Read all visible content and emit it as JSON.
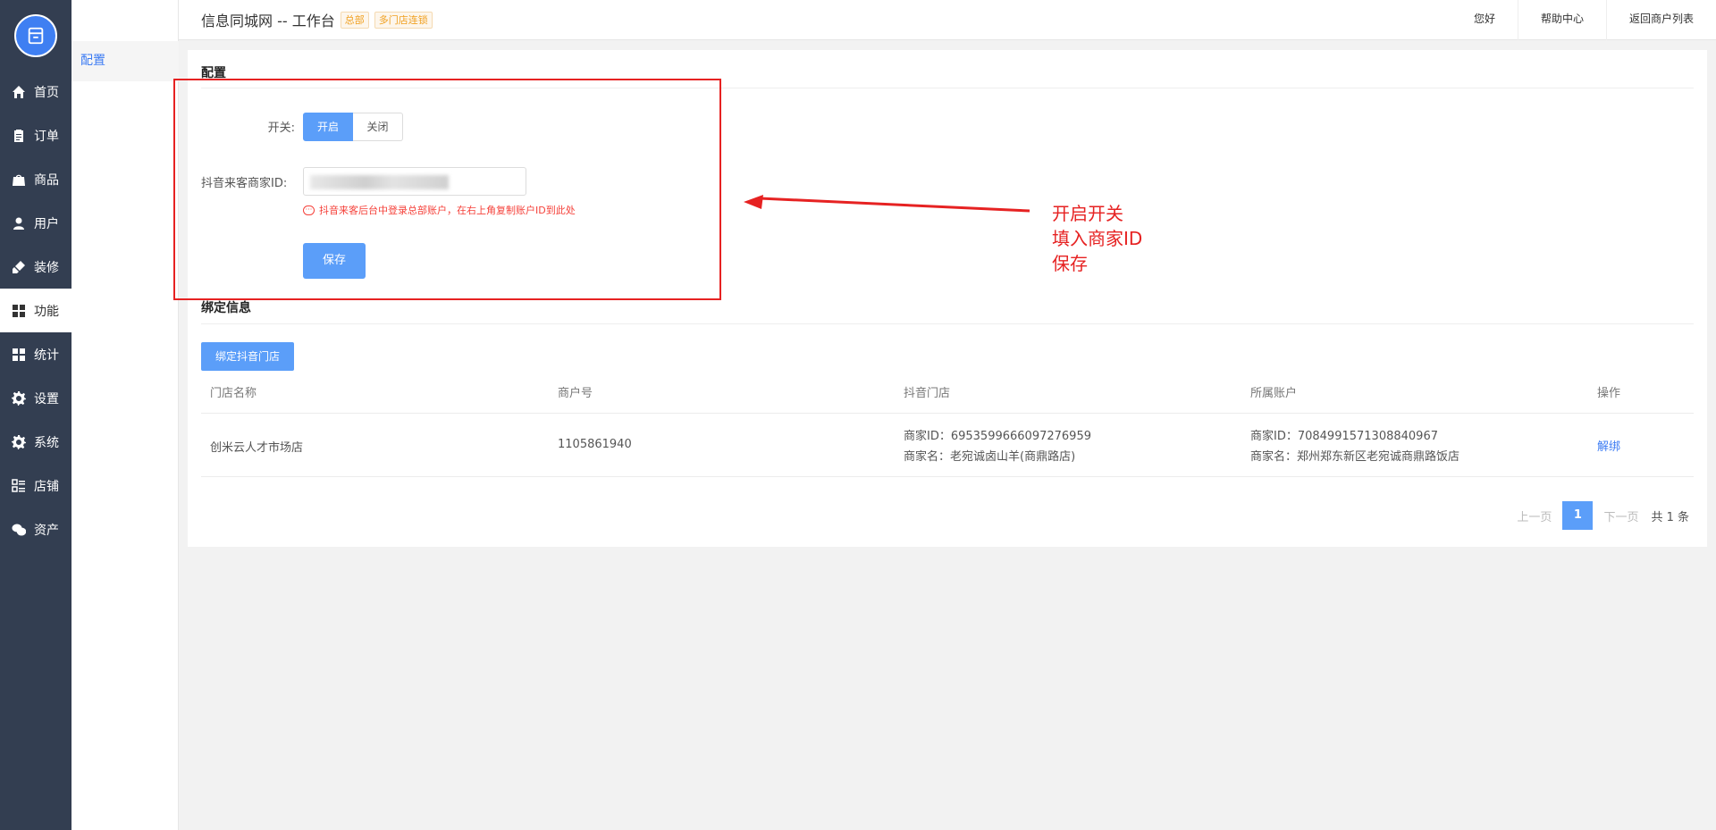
{
  "nav": {
    "items": [
      {
        "label": "首页",
        "icon": "home-icon"
      },
      {
        "label": "订单",
        "icon": "clipboard-icon"
      },
      {
        "label": "商品",
        "icon": "bag-icon"
      },
      {
        "label": "用户",
        "icon": "user-icon"
      },
      {
        "label": "装修",
        "icon": "brush-icon"
      },
      {
        "label": "功能",
        "icon": "grid-icon",
        "active": true
      },
      {
        "label": "统计",
        "icon": "grid-icon"
      },
      {
        "label": "设置",
        "icon": "gear-icon"
      },
      {
        "label": "系统",
        "icon": "gear-icon"
      },
      {
        "label": "店铺",
        "icon": "list-icon"
      },
      {
        "label": "资产",
        "icon": "wechat-icon"
      }
    ]
  },
  "subnav": {
    "active_label": "配置"
  },
  "topbar": {
    "title": "信息同城网 -- 工作台",
    "badge1": "总部",
    "badge2": "多门店连锁",
    "links": [
      "您好",
      "帮助中心",
      "返回商户列表"
    ]
  },
  "config": {
    "section_title": "配置",
    "switch_label": "开关:",
    "switch_on": "开启",
    "switch_off": "关闭",
    "merchant_id_label": "抖音来客商家ID:",
    "merchant_id_value": "",
    "hint": "抖音来客后台中登录总部账户，在右上角复制账户ID到此处",
    "save_label": "保存"
  },
  "bind": {
    "section_title": "绑定信息",
    "bind_button": "绑定抖音门店",
    "columns": [
      "门店名称",
      "商户号",
      "抖音门店",
      "所属账户",
      "操作"
    ],
    "rows": [
      {
        "store_name": "创米云人才市场店",
        "merchant_no": "1105861940",
        "douyin_id": "商家ID：6953599666097276959",
        "douyin_name": "商家名：老宛诚卤山羊(商鼎路店)",
        "account_id": "商家ID：7084991571308840967",
        "account_name": "商家名：郑州郑东新区老宛诚商鼎路饭店",
        "action": "解绑"
      }
    ]
  },
  "pager": {
    "prev": "上一页",
    "current": "1",
    "next": "下一页",
    "total": "共 1 条"
  },
  "annotation": {
    "lines": [
      "开启开关",
      "填入商家ID",
      "保存"
    ],
    "color": "#e62222"
  },
  "colors": {
    "nav_bg": "#333e51",
    "accent": "#5b9ef9",
    "danger": "#f5413a"
  }
}
